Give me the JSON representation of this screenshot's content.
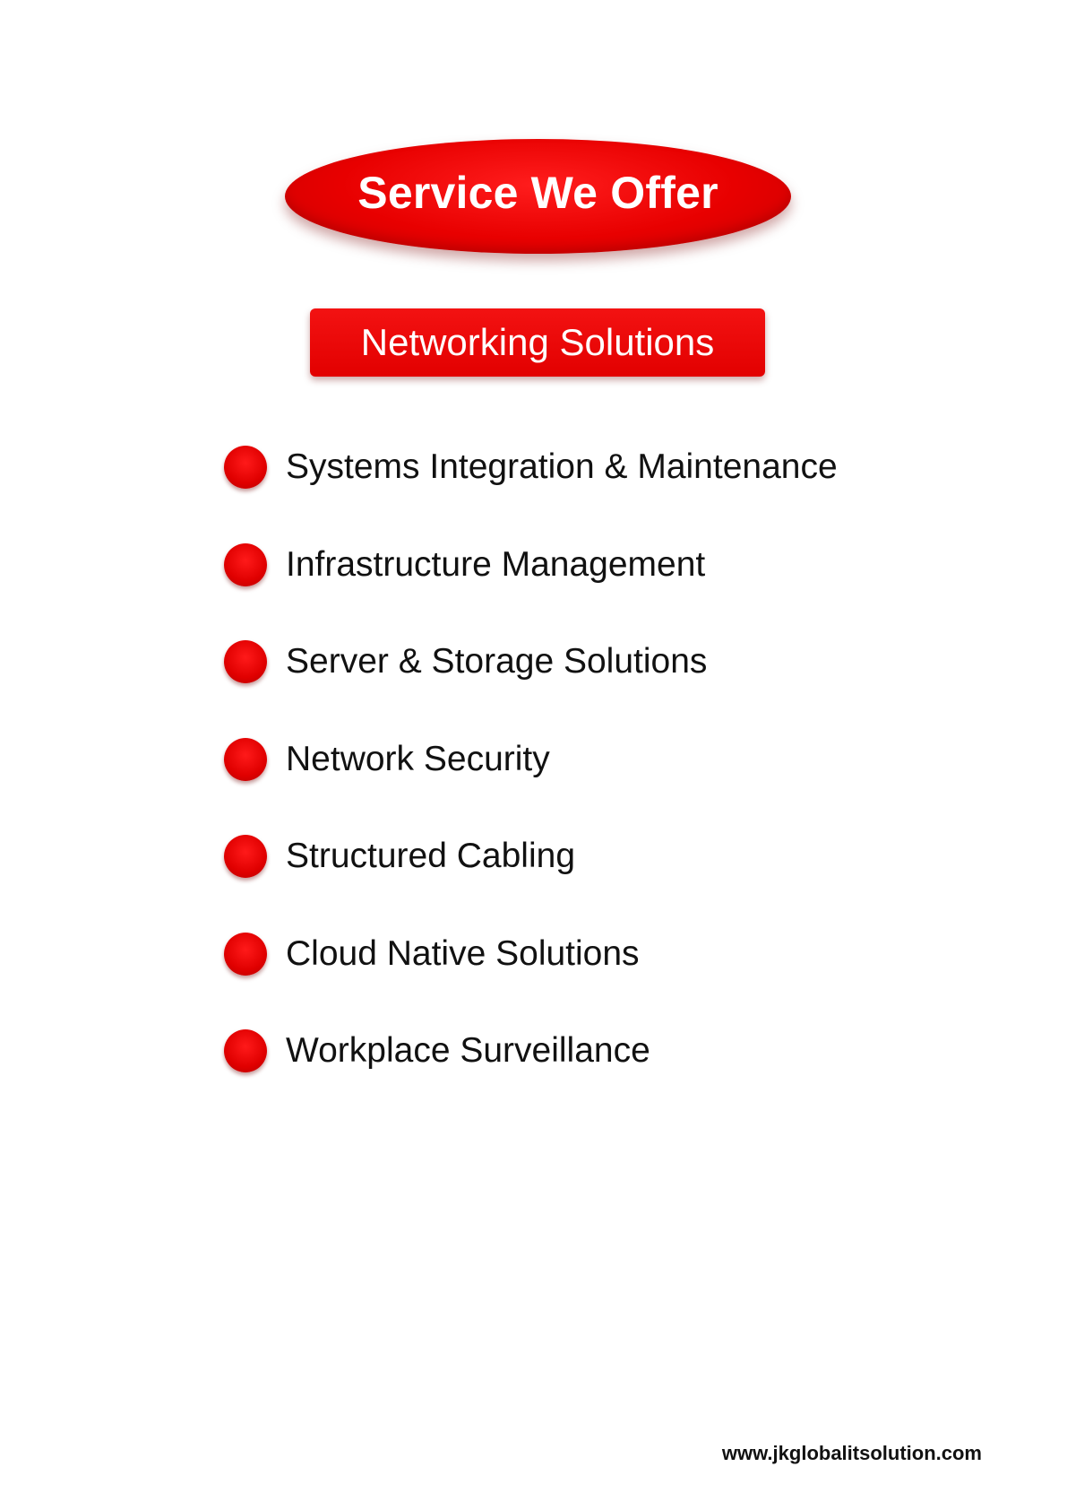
{
  "title": "Service We Offer",
  "subtitle": "Networking Solutions",
  "services": [
    "Systems Integration & Maintenance",
    "Infrastructure Management",
    "Server & Storage Solutions",
    "Network Security",
    "Structured Cabling",
    "Cloud Native Solutions",
    "Workplace Surveillance"
  ],
  "footer": {
    "url": "www.jkglobalitsolution.com"
  },
  "colors": {
    "accent": "#e80000",
    "text": "#111111",
    "background": "#ffffff"
  },
  "icons": {
    "bullet": "red-circle-bullet-icon"
  }
}
